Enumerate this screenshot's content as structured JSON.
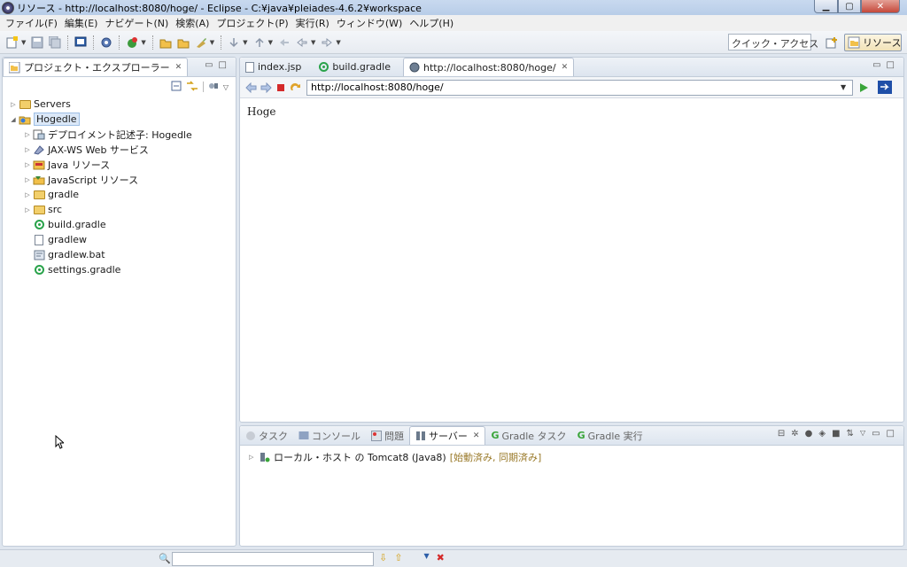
{
  "window": {
    "title": "リソース - http://localhost:8080/hoge/ - Eclipse - C:¥java¥pleiades-4.6.2¥workspace"
  },
  "menu": [
    "ファイル(F)",
    "編集(E)",
    "ナビゲート(N)",
    "検索(A)",
    "プロジェクト(P)",
    "実行(R)",
    "ウィンドウ(W)",
    "ヘルプ(H)"
  ],
  "toolbar": {
    "quick_access": "クイック・アクセス",
    "perspective": "リソース"
  },
  "explorer": {
    "title": "プロジェクト・エクスプローラー",
    "tree": [
      {
        "label": "Servers",
        "level": 0,
        "arrow": "▷",
        "icon": "folder"
      },
      {
        "label": "Hogedle",
        "level": 0,
        "arrow": "◢",
        "icon": "project",
        "selected": true
      },
      {
        "label": "デプロイメント記述子: Hogedle",
        "level": 1,
        "arrow": "▷",
        "icon": "deploy"
      },
      {
        "label": "JAX-WS Web サービス",
        "level": 1,
        "arrow": "▷",
        "icon": "webservice"
      },
      {
        "label": "Java リソース",
        "level": 1,
        "arrow": "▷",
        "icon": "java"
      },
      {
        "label": "JavaScript リソース",
        "level": 1,
        "arrow": "▷",
        "icon": "javascript"
      },
      {
        "label": "gradle",
        "level": 1,
        "arrow": "▷",
        "icon": "folder"
      },
      {
        "label": "src",
        "level": 1,
        "arrow": "▷",
        "icon": "folder"
      },
      {
        "label": "build.gradle",
        "level": 1,
        "arrow": "",
        "icon": "gradle"
      },
      {
        "label": "gradlew",
        "level": 1,
        "arrow": "",
        "icon": "file"
      },
      {
        "label": "gradlew.bat",
        "level": 1,
        "arrow": "",
        "icon": "bat"
      },
      {
        "label": "settings.gradle",
        "level": 1,
        "arrow": "",
        "icon": "gradle"
      }
    ]
  },
  "editor": {
    "tabs": [
      {
        "label": "index.jsp",
        "icon": "jsp"
      },
      {
        "label": "build.gradle",
        "icon": "gradle"
      },
      {
        "label": "http://localhost:8080/hoge/",
        "icon": "browser",
        "active": true
      }
    ],
    "url": "http://localhost:8080/hoge/",
    "content": "Hoge"
  },
  "bottom": {
    "tabs": [
      {
        "label": "タスク",
        "icon": "task"
      },
      {
        "label": "コンソール",
        "icon": "console"
      },
      {
        "label": "問題",
        "icon": "problems"
      },
      {
        "label": "サーバー",
        "icon": "servers",
        "active": true
      },
      {
        "label": "Gradle タスク",
        "icon": "gradle-g"
      },
      {
        "label": "Gradle 実行",
        "icon": "gradle-g"
      }
    ],
    "server": {
      "name": "ローカル・ホスト の Tomcat8 (Java8)",
      "status": "[始動済み, 同期済み]"
    }
  }
}
